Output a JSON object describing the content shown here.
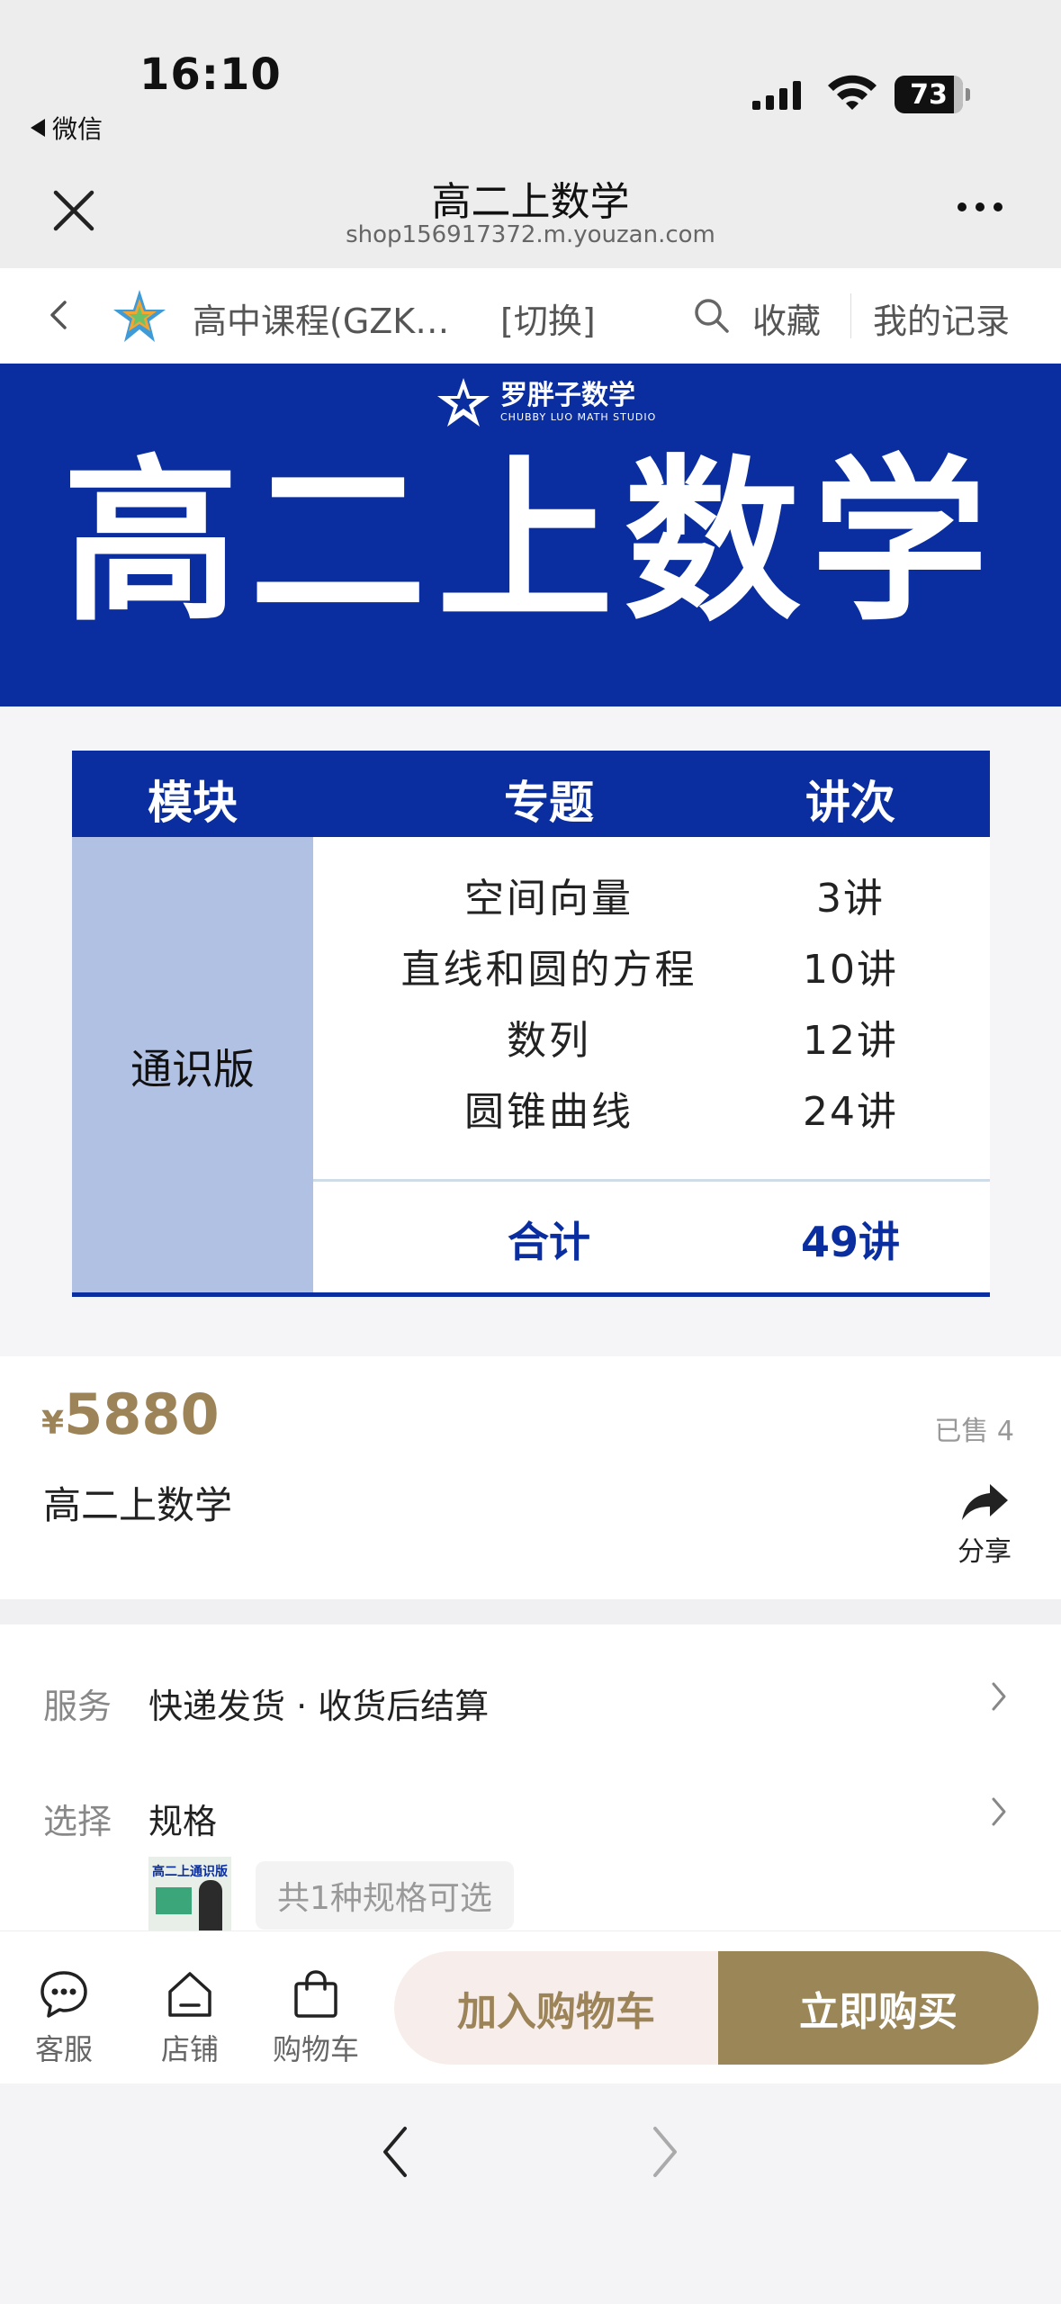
{
  "status_bar": {
    "time": "16:10",
    "back_app": "微信",
    "battery": "73"
  },
  "wechat_nav": {
    "title": "高二上数学",
    "url": "shop156917372.m.youzan.com",
    "close_icon": "close-icon",
    "more_icon": "more-dots-icon"
  },
  "shop_header": {
    "shop_name": "高中课程(GZK…",
    "switch_label": "[切换]",
    "favorite_label": "收藏",
    "records_label": "我的记录"
  },
  "banner": {
    "brand_cn": "罗胖子数学",
    "brand_en": "CHUBBY LUO MATH STUDIO",
    "title": "高二上数学",
    "table": {
      "headers": [
        "模块",
        "专题",
        "讲次"
      ],
      "module": "通识版",
      "rows": [
        {
          "topic": "空间向量",
          "count": "3讲"
        },
        {
          "topic": "直线和圆的方程",
          "count": "10讲"
        },
        {
          "topic": "数列",
          "count": "12讲"
        },
        {
          "topic": "圆锥曲线",
          "count": "24讲"
        }
      ],
      "total_label": "合计",
      "total_value": "49讲"
    },
    "colors": {
      "primary": "#0a2ea0",
      "module_bg": "#b1c1e4"
    }
  },
  "product": {
    "currency": "¥",
    "price": "5880",
    "sold": "已售 4",
    "name": "高二上数学",
    "share_label": "分享",
    "price_color": "#9c8458"
  },
  "info": {
    "service_key": "服务",
    "service_value": "快递发货 · 收货后结算",
    "spec_key": "选择",
    "spec_value": "规格",
    "spec_thumb_text": "高二上通识版",
    "spec_count": "共1种规格可选"
  },
  "action_bar": {
    "service_label": "客服",
    "store_label": "店铺",
    "cart_label": "购物车",
    "add_to_cart": "加入购物车",
    "buy_now": "立即购买",
    "buy_color": "#9b8658"
  }
}
